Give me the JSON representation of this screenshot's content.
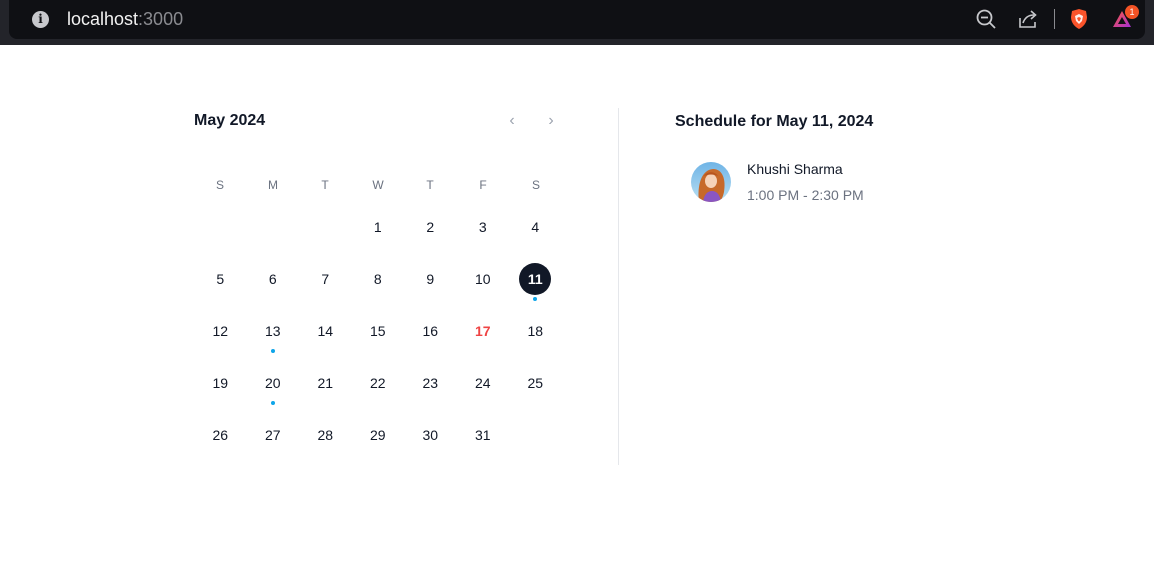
{
  "browser": {
    "url_host": "localhost",
    "url_port": ":3000",
    "notification_count": "1",
    "icons": [
      "info-icon",
      "zoom-out-icon",
      "share-icon",
      "brave-shield-icon",
      "brave-rewards-icon"
    ]
  },
  "calendar": {
    "month_label": "May 2024",
    "prev_label": "‹",
    "next_label": "›",
    "weekdays": [
      "S",
      "M",
      "T",
      "W",
      "T",
      "F",
      "S"
    ],
    "leading_blanks": 3,
    "days_in_month": 31,
    "selected_day": 11,
    "today_day": 17,
    "event_days": [
      11,
      13,
      20
    ],
    "colors": {
      "selected_bg": "#111827",
      "today_text": "#ef4444",
      "event_dot": "#0ea5e9"
    }
  },
  "schedule": {
    "title": "Schedule for May 11, 2024",
    "events": [
      {
        "name": "Khushi Sharma",
        "time": "1:00 PM - 2:30 PM"
      }
    ]
  }
}
